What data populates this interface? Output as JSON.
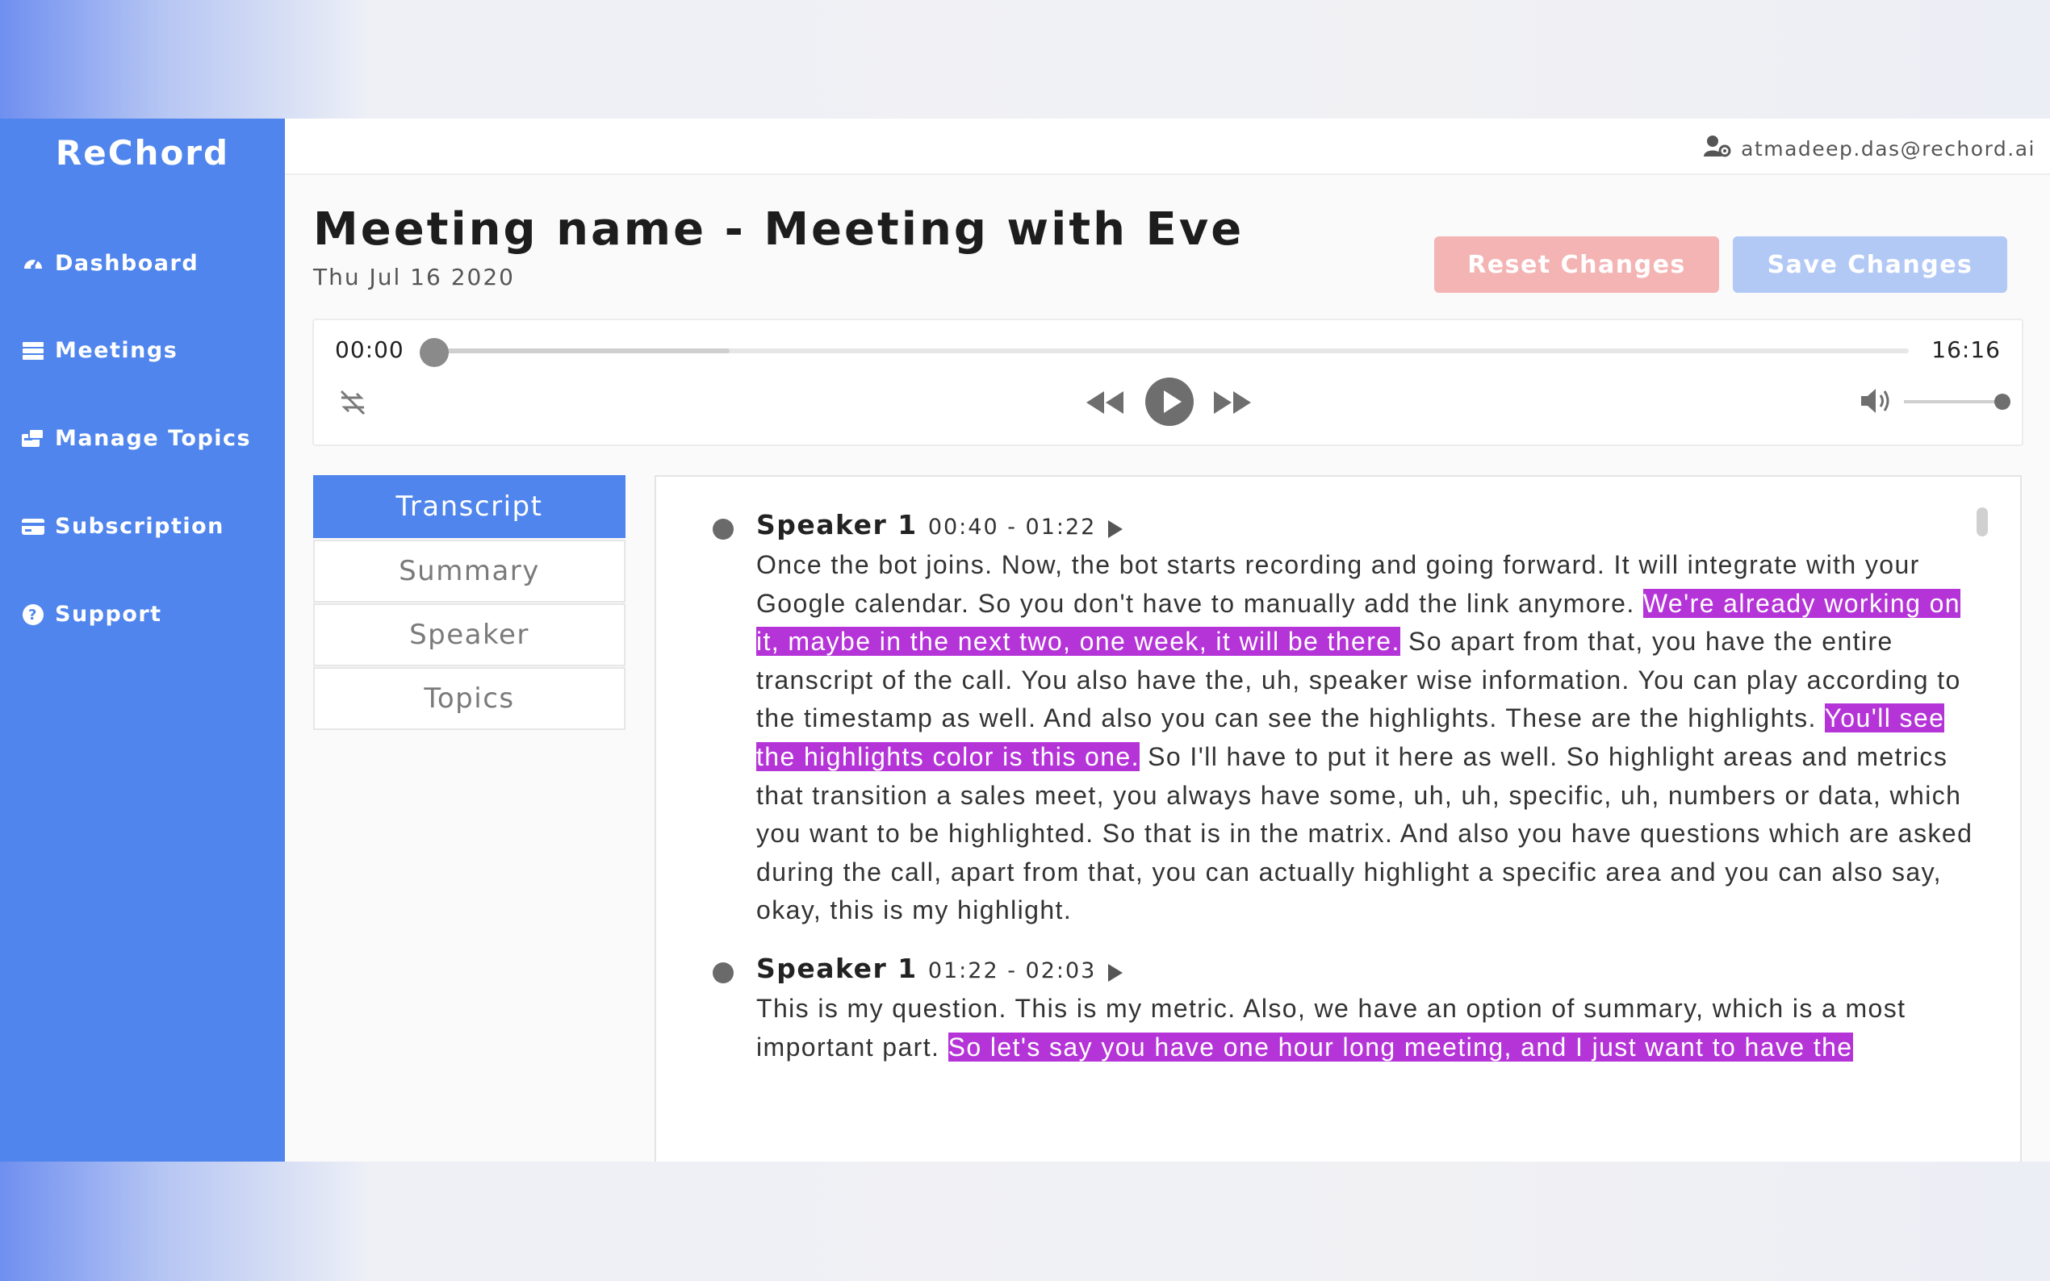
{
  "brand": {
    "name": "ReChord"
  },
  "sidebar": {
    "items": [
      {
        "label": "Dashboard",
        "icon": "dashboard-gauge-icon"
      },
      {
        "label": "Meetings",
        "icon": "list-icon"
      },
      {
        "label": "Manage Topics",
        "icon": "topics-icon"
      },
      {
        "label": "Subscription",
        "icon": "credit-card-icon"
      },
      {
        "label": "Support",
        "icon": "question-circle-icon"
      }
    ]
  },
  "topbar": {
    "user_email": "atmadeep.das@rechord.ai",
    "user_icon": "user-cog-icon"
  },
  "header": {
    "title": "Meeting name - Meeting with Eve",
    "date": "Thu Jul 16 2020",
    "reset_label": "Reset Changes",
    "save_label": "Save Changes"
  },
  "player": {
    "current_time": "00:00",
    "duration": "16:16",
    "progress": 0,
    "buffered": 0.2,
    "volume": 1.0
  },
  "tabs": [
    {
      "label": "Transcript",
      "active": true
    },
    {
      "label": "Summary",
      "active": false
    },
    {
      "label": "Speaker",
      "active": false
    },
    {
      "label": "Topics",
      "active": false
    }
  ],
  "transcript": [
    {
      "speaker": "Speaker 1",
      "range": "00:40 - 01:22",
      "segments": [
        {
          "text": "Once the bot joins. Now, the bot starts recording and going forward. It will integrate with your Google calendar. So you don't have to manually add the link anymore. ",
          "highlight": false
        },
        {
          "text": "We're already working on it, maybe in the next two, one week, it will be there.",
          "highlight": true
        },
        {
          "text": " So apart from that, you have the entire transcript of the call. You also have the, uh, speaker wise information. You can play according to the timestamp as well. And also you can see the highlights. These are the highlights. ",
          "highlight": false
        },
        {
          "text": "You'll see the highlights color is this one.",
          "highlight": true
        },
        {
          "text": " So I'll have to put it here as well. So highlight areas and metrics that transition a sales meet, you always have some, uh, uh, specific, uh, numbers or data, which you want to be highlighted. So that is in the matrix. And also you have questions which are asked during the call, apart from that, you can actually highlight a specific area and you can also say, okay, this is my highlight.",
          "highlight": false
        }
      ]
    },
    {
      "speaker": "Speaker 1",
      "range": "01:22 - 02:03",
      "segments": [
        {
          "text": "This is my question. This is my metric. Also, we have an option of summary, which is a most important part. ",
          "highlight": false
        },
        {
          "text": "So let's say you have one hour long meeting, and I just want to have the",
          "highlight": true
        }
      ]
    }
  ],
  "colors": {
    "primary": "#4f85ec",
    "highlight": "#b534d8",
    "reset": "#f4b4b4",
    "save": "#b3c9f5"
  }
}
